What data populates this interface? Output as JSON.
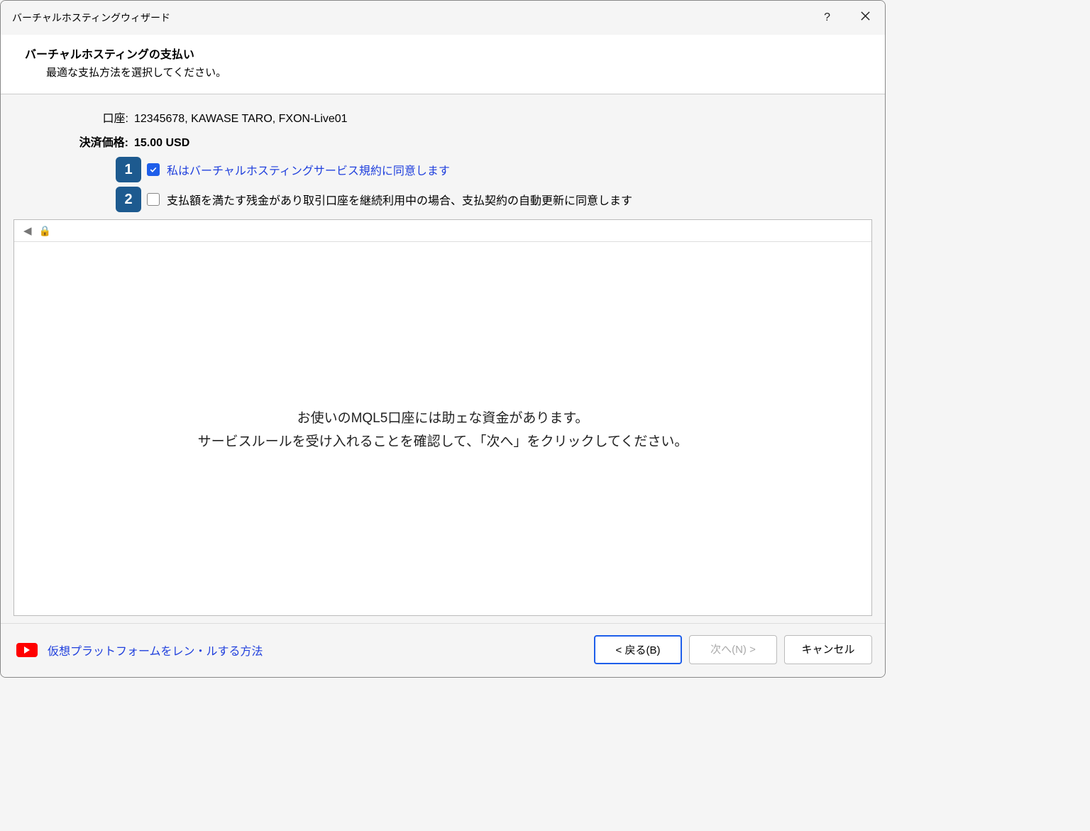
{
  "window": {
    "title": "バーチャルホスティングウィザード"
  },
  "header": {
    "title": "バーチャルホスティングの支払い",
    "subtitle": "最適な支払方法を選択してください。"
  },
  "account": {
    "label": "口座:",
    "value": "12345678, KAWASE TARO, FXON-Live01"
  },
  "price": {
    "label": "決済価格:",
    "value": "15.00 USD"
  },
  "badges": {
    "one": "1",
    "two": "2"
  },
  "checks": {
    "agree_terms": "私はバーチャルホスティングサービス規約に同意します",
    "auto_renew": "支払額を満たす残金があり取引口座を継続利用中の場合、支払契約の自動更新に同意します"
  },
  "pane": {
    "msg1": "お使いのMQL5口座には助ェな資金があります。",
    "msg2": "サービスルールを受け入れることを確認して、「次へ」をクリックしてください。"
  },
  "footer": {
    "link": "仮想プラットフォームをレン・ルする方法",
    "back": "< 戻る(B)",
    "next": "次へ(N) >",
    "cancel": "キャンセル"
  }
}
